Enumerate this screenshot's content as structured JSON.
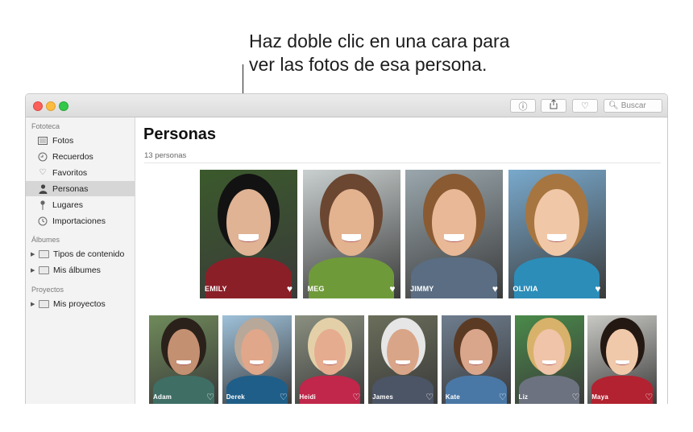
{
  "callout": {
    "line1": "Haz doble clic en una cara para",
    "line2": "ver las fotos de esa persona."
  },
  "toolbar": {
    "info_icon": "info-icon",
    "share_icon": "share-icon",
    "favorite_icon": "heart-icon",
    "search_placeholder": "Buscar"
  },
  "sidebar": {
    "sections": [
      {
        "header": "Fototeca",
        "items": [
          {
            "label": "Fotos",
            "icon": "photos-icon"
          },
          {
            "label": "Recuerdos",
            "icon": "memories-icon"
          },
          {
            "label": "Favoritos",
            "icon": "heart-icon"
          },
          {
            "label": "Personas",
            "icon": "person-icon",
            "selected": true
          },
          {
            "label": "Lugares",
            "icon": "pin-icon"
          },
          {
            "label": "Importaciones",
            "icon": "clock-icon"
          }
        ]
      },
      {
        "header": "Álbumes",
        "items": [
          {
            "label": "Tipos de contenido",
            "icon": "folder-icon"
          },
          {
            "label": "Mis álbumes",
            "icon": "folder-icon"
          }
        ]
      },
      {
        "header": "Proyectos",
        "items": [
          {
            "label": "Mis proyectos",
            "icon": "folder-icon"
          }
        ]
      }
    ]
  },
  "main": {
    "title": "Personas",
    "count": "13 personas",
    "favorites": [
      {
        "name": "EMILY",
        "bg": "#3b5a2c",
        "skin": "#e0b394",
        "shirt": "#8a1f28",
        "hair": "#121212"
      },
      {
        "name": "MEG",
        "bg": "#c9d0cf",
        "skin": "#e3b28f",
        "shirt": "#6f9a3a",
        "hair": "#6b4631"
      },
      {
        "name": "JIMMY",
        "bg": "#9aa7ad",
        "skin": "#e9b896",
        "shirt": "#5a6d82",
        "hair": "#8a5a32"
      },
      {
        "name": "OLIVIA",
        "bg": "#79a9cc",
        "skin": "#f0c8a8",
        "shirt": "#2c8db9",
        "hair": "#a7753f"
      }
    ],
    "people": [
      {
        "name": "Adam",
        "bg": "#6f8a5a",
        "skin": "#c49072",
        "shirt": "#3f6e65",
        "hair": "#2b211b"
      },
      {
        "name": "Derek",
        "bg": "#9ec1da",
        "skin": "#e0a78a",
        "shirt": "#1f5e88",
        "hair": "#b8a89a"
      },
      {
        "name": "Heidi",
        "bg": "#8a9080",
        "skin": "#e6ac90",
        "shirt": "#c0274a",
        "hair": "#e4d0a8"
      },
      {
        "name": "James",
        "bg": "#6a6e5a",
        "skin": "#d9a588",
        "shirt": "#4c5566",
        "hair": "#e6e6e6"
      },
      {
        "name": "Kate",
        "bg": "#6e7d8e",
        "skin": "#d9a68c",
        "shirt": "#4a78a6",
        "hair": "#5b3a24"
      },
      {
        "name": "Liz",
        "bg": "#4a8a4a",
        "skin": "#efc4a8",
        "shirt": "#6d7280",
        "hair": "#d8b26a"
      },
      {
        "name": "Maya",
        "bg": "#c8c8c4",
        "skin": "#f0c9aa",
        "shirt": "#b22230",
        "hair": "#241812"
      }
    ]
  }
}
